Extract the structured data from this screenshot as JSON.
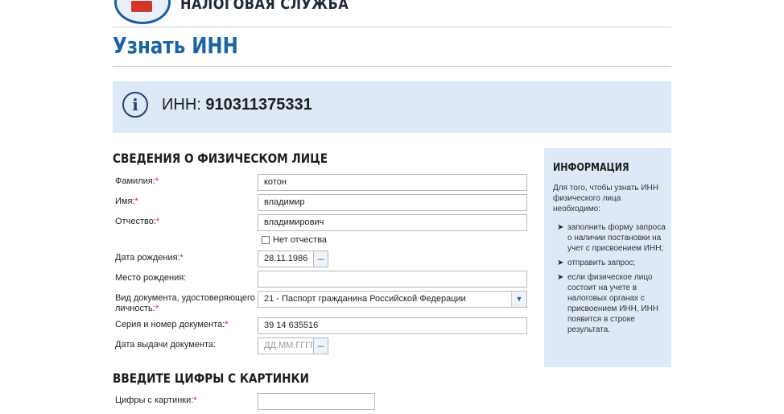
{
  "header": {
    "title": "НАЛОГОВАЯ СЛУЖБА"
  },
  "page_title": "Узнать ИНН",
  "result": {
    "label": "ИНН:",
    "value": "910311375331"
  },
  "personal": {
    "title": "СВЕДЕНИЯ О ФИЗИЧЕСКОМ ЛИЦЕ",
    "surname": {
      "label": "Фамилия:",
      "value": "котон"
    },
    "name": {
      "label": "Имя:",
      "value": "владимир"
    },
    "patronymic": {
      "label": "Отчество:",
      "value": "владимирович"
    },
    "no_patronymic": {
      "label": "Нет отчества",
      "checked": false
    },
    "birth_date": {
      "label": "Дата рождения:",
      "value": "28.11.1986",
      "button": "..."
    },
    "birth_place": {
      "label": "Место рождения:",
      "value": ""
    },
    "doc_type": {
      "label_line1": "Вид документа, удостоверяющего",
      "label_line2": "личность:",
      "value": "21 - Паспорт гражданина Российской Федерации"
    },
    "doc_number": {
      "label": "Серия и номер документа:",
      "value": "39 14 635516"
    },
    "doc_issue_date": {
      "label": "Дата выдачи документа:",
      "placeholder": "ДД.ММ.ГГГГ",
      "button": "..."
    }
  },
  "captcha": {
    "title": "ВВЕДИТЕ ЦИФРЫ С КАРТИНКИ",
    "label": "Цифры с картинки:",
    "value": ""
  },
  "required_mark": "*",
  "info_panel": {
    "title": "ИНФОРМАЦИЯ",
    "intro": "Для того, чтобы узнать ИНН физического лица необходимо:",
    "items": [
      "заполнить форму запроса о наличии постановки на учет с присвоением ИНН;",
      "отправить запрос;",
      "если физическое лицо состоит на учете в налоговых органах с присвоением ИНН, ИНН появится в строке результата."
    ],
    "bullet": "➤"
  },
  "colors": {
    "accent": "#1a63a6",
    "panel": "#dde9f6",
    "required": "#d02a2a"
  },
  "icons": {
    "info": "info-icon",
    "logo": "fns-emblem-logo",
    "calendar": "calendar-picker-icon",
    "dropdown": "chevron-down-icon"
  }
}
